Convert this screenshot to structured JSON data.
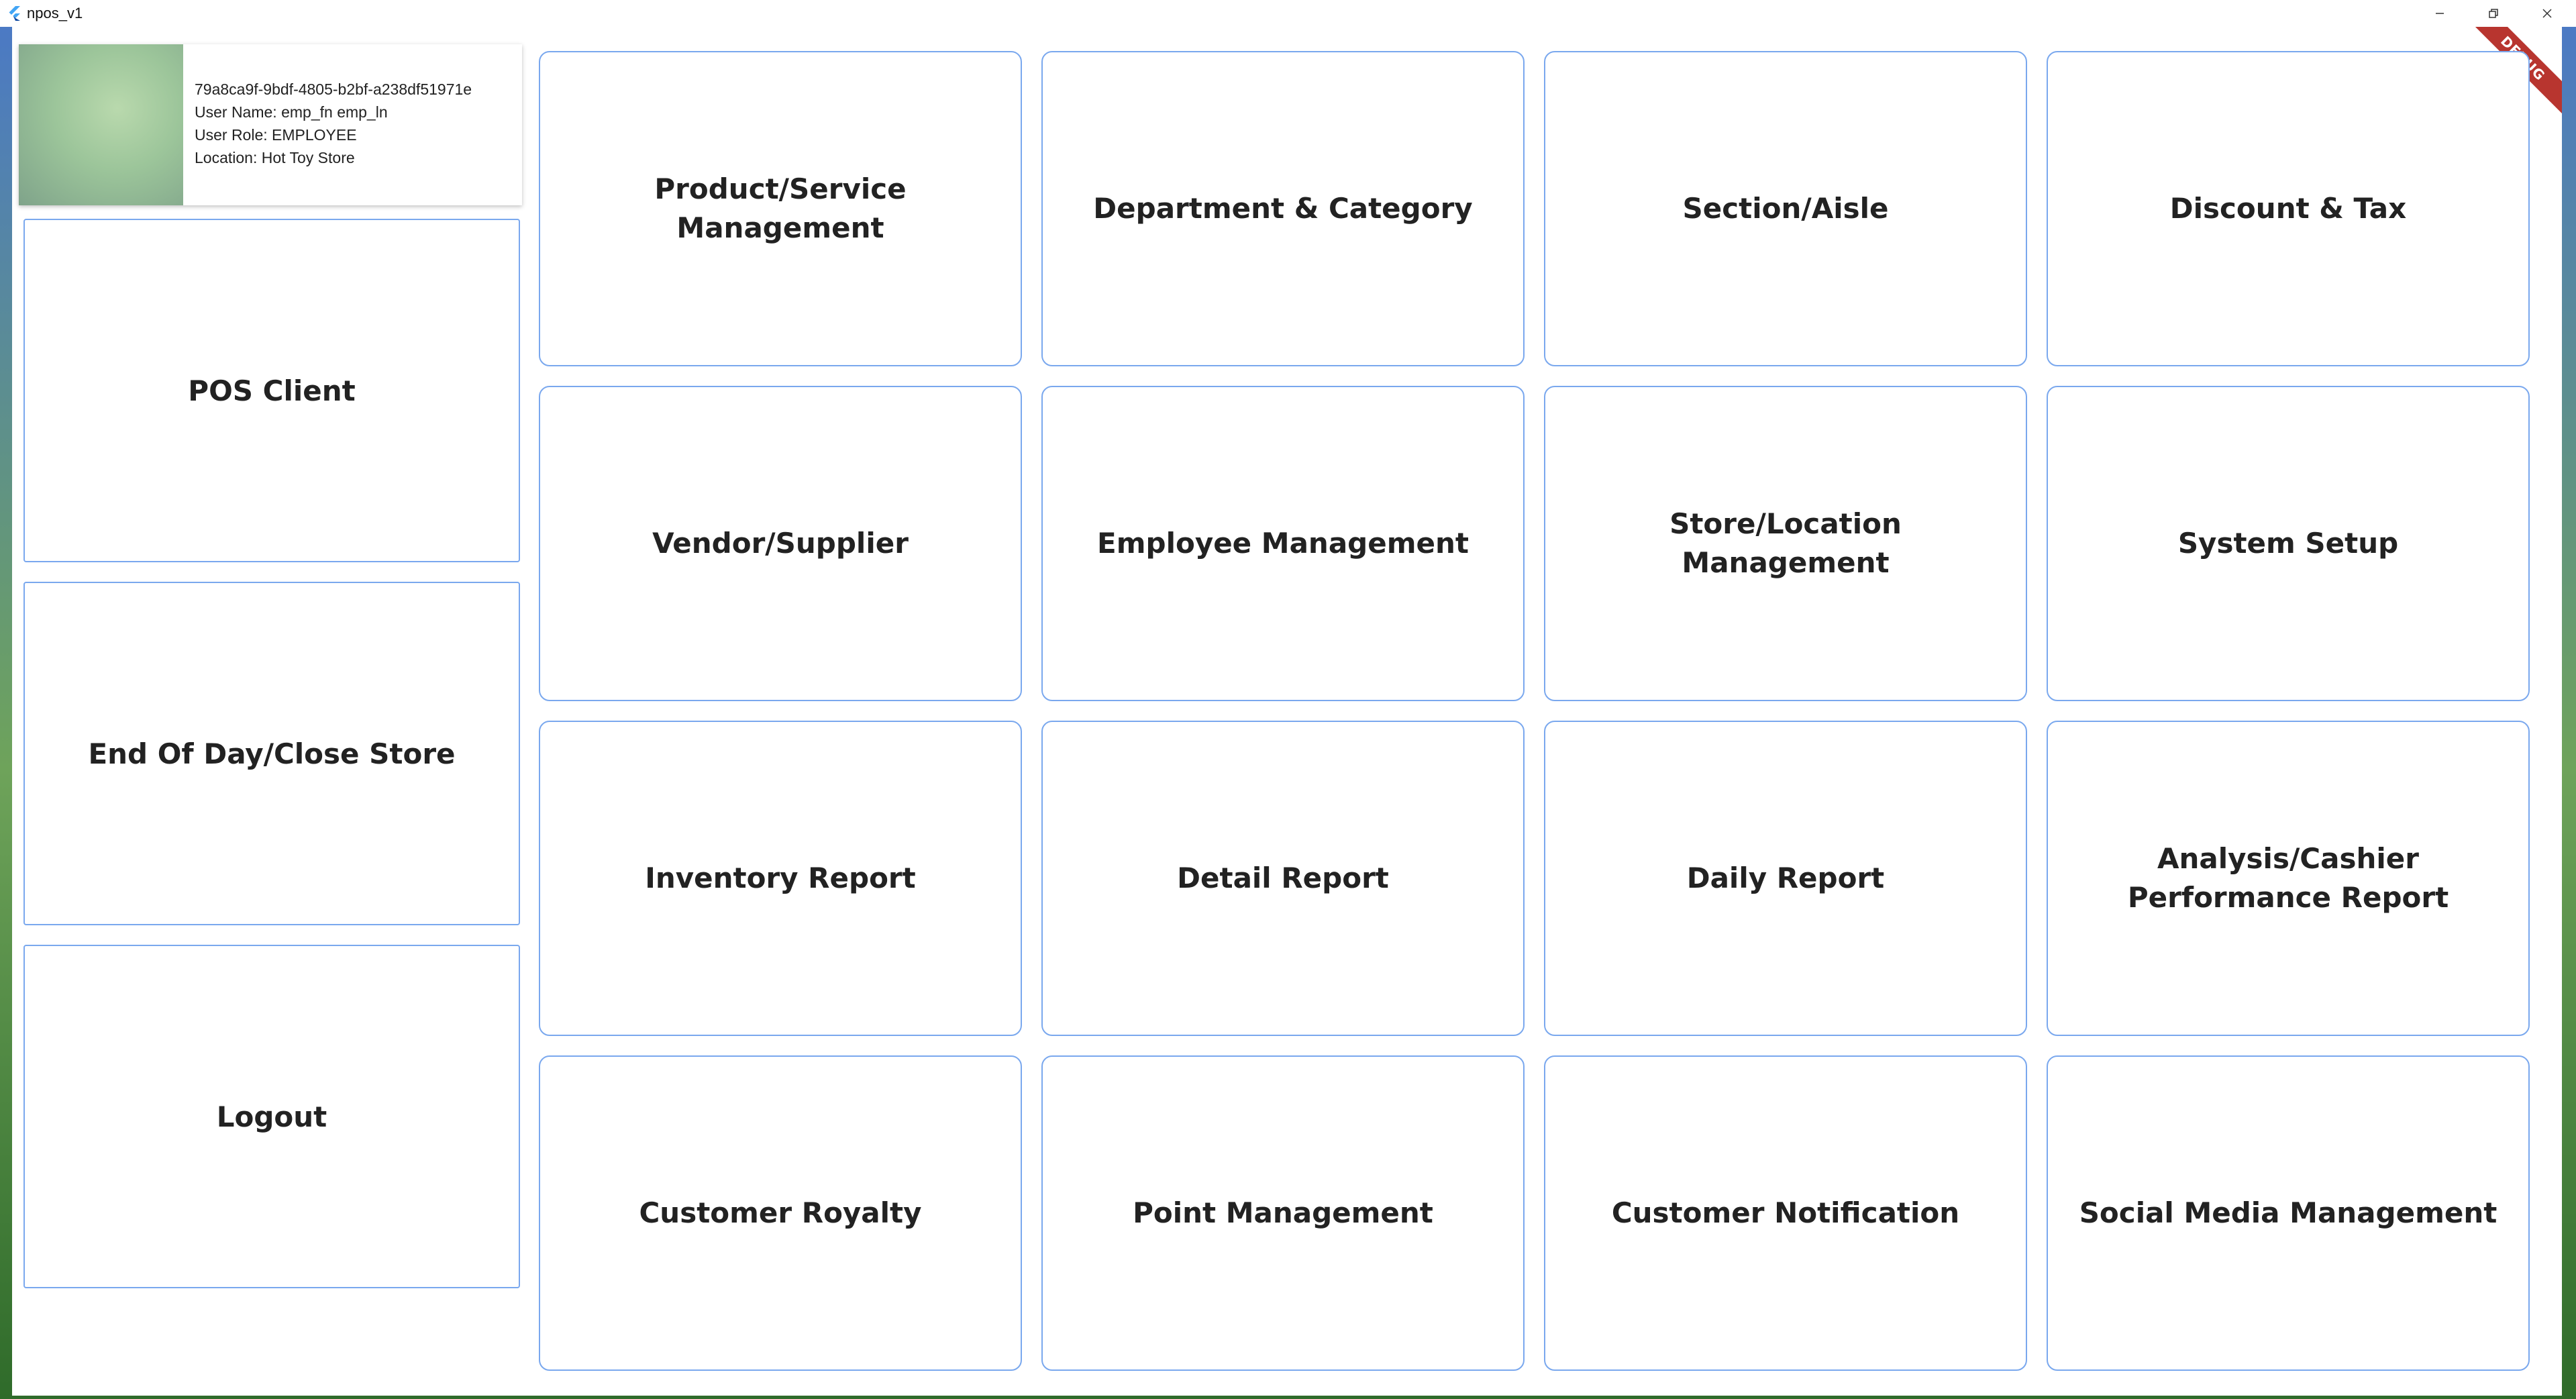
{
  "window": {
    "title": "npos_v1",
    "debug_banner": "DEBUG"
  },
  "user": {
    "id": "79a8ca9f-9bdf-4805-b2bf-a238df51971e",
    "name_line": "User Name: emp_fn emp_ln",
    "role_line": "User Role: EMPLOYEE",
    "location_line": "Location: Hot Toy Store"
  },
  "left_actions": [
    {
      "label": "POS Client"
    },
    {
      "label": "End Of Day/Close Store"
    },
    {
      "label": "Logout"
    }
  ],
  "menu_tiles": [
    {
      "label": "Product/Service Management"
    },
    {
      "label": "Department & Category"
    },
    {
      "label": "Section/Aisle"
    },
    {
      "label": "Discount & Tax"
    },
    {
      "label": "Vendor/Supplier"
    },
    {
      "label": "Employee Management"
    },
    {
      "label": "Store/Location Management"
    },
    {
      "label": "System Setup"
    },
    {
      "label": "Inventory Report"
    },
    {
      "label": "Detail Report"
    },
    {
      "label": "Daily Report"
    },
    {
      "label": "Analysis/Cashier Performance Report"
    },
    {
      "label": "Customer Royalty"
    },
    {
      "label": "Point Management"
    },
    {
      "label": "Customer Notification"
    },
    {
      "label": "Social Media Management"
    }
  ],
  "colors": {
    "tile_border": "#7aa8ee",
    "debug_ribbon": "#b8352f"
  }
}
